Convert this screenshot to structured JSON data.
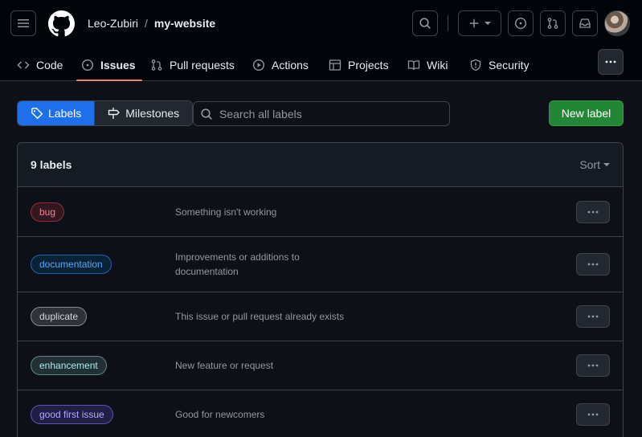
{
  "header": {
    "owner": "Leo-Zubiri",
    "separator": "/",
    "repo": "my-website"
  },
  "nav": {
    "tabs": [
      {
        "label": "Code",
        "icon": "code-icon"
      },
      {
        "label": "Issues",
        "icon": "issue-opened-icon",
        "active": true
      },
      {
        "label": "Pull requests",
        "icon": "git-pull-request-icon"
      },
      {
        "label": "Actions",
        "icon": "play-icon"
      },
      {
        "label": "Projects",
        "icon": "table-icon"
      },
      {
        "label": "Wiki",
        "icon": "book-icon"
      },
      {
        "label": "Security",
        "icon": "shield-icon"
      }
    ]
  },
  "toolbar": {
    "labels_tab": "Labels",
    "milestones_tab": "Milestones",
    "search_placeholder": "Search all labels",
    "new_label": "New label"
  },
  "labels_box": {
    "count_text": "9 labels",
    "sort_label": "Sort",
    "rows": [
      {
        "name": "bug",
        "description": "Something isn't working",
        "color": "#d73a4a"
      },
      {
        "name": "documentation",
        "description": "Improvements or additions to documentation",
        "color": "#0075ca"
      },
      {
        "name": "duplicate",
        "description": "This issue or pull request already exists",
        "color": "#cfd3d7"
      },
      {
        "name": "enhancement",
        "description": "New feature or request",
        "color": "#a2eeef"
      },
      {
        "name": "good first issue",
        "description": "Good for newcomers",
        "color": "#7057ff"
      }
    ]
  },
  "colors": {
    "accent": "#1f6feb",
    "primary_button": "#238636",
    "active_tab_underline": "#f78166"
  }
}
